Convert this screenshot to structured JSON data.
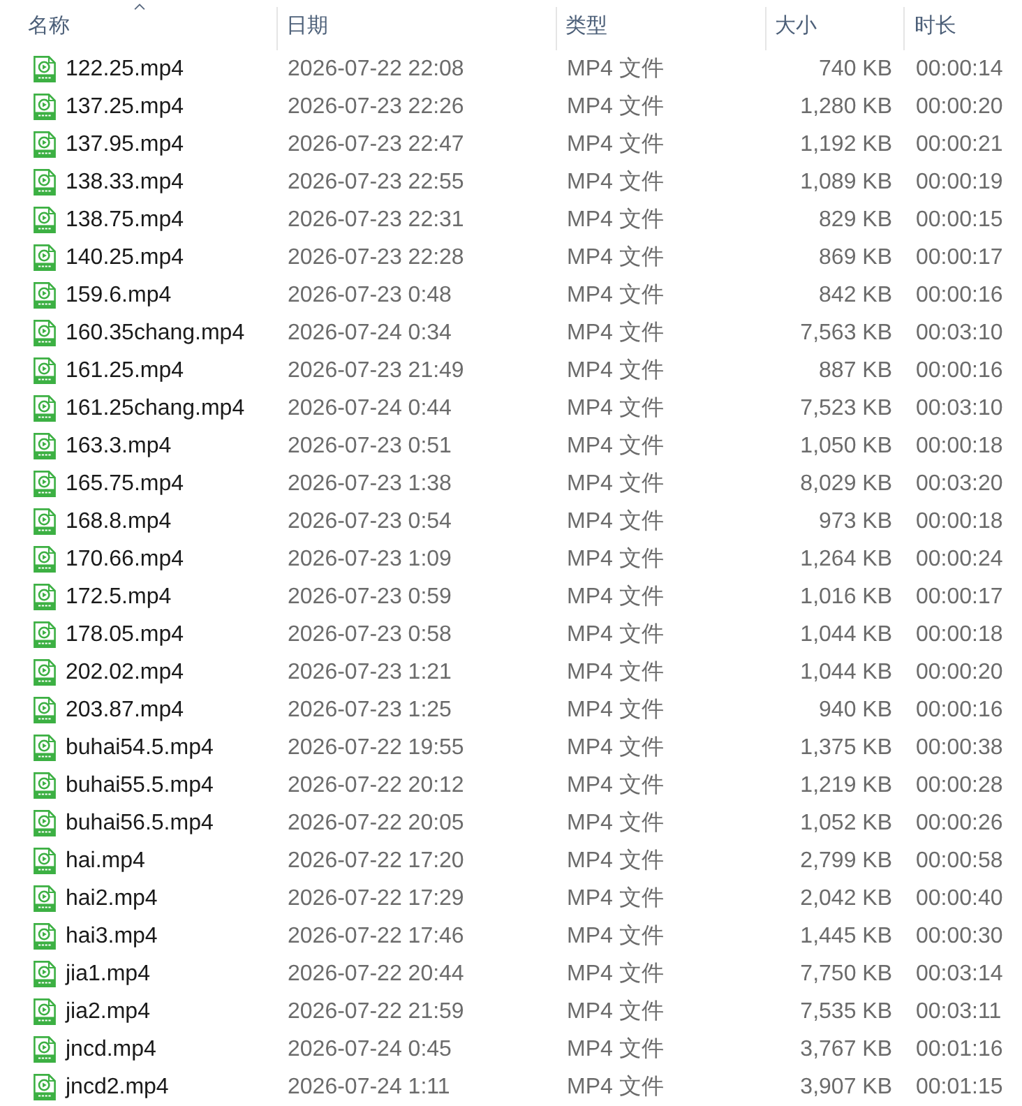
{
  "table": {
    "columns": [
      {
        "label": "名称",
        "sorted": true
      },
      {
        "label": "日期",
        "sorted": false
      },
      {
        "label": "类型",
        "sorted": false
      },
      {
        "label": "大小",
        "sorted": false
      },
      {
        "label": "时长",
        "sorted": false
      }
    ],
    "rows": [
      {
        "name": "122.25.mp4",
        "date": "2026-07-22 22:08",
        "type": "MP4 文件",
        "size": "740 KB",
        "duration": "00:00:14"
      },
      {
        "name": "137.25.mp4",
        "date": "2026-07-23 22:26",
        "type": "MP4 文件",
        "size": "1,280 KB",
        "duration": "00:00:20"
      },
      {
        "name": "137.95.mp4",
        "date": "2026-07-23 22:47",
        "type": "MP4 文件",
        "size": "1,192 KB",
        "duration": "00:00:21"
      },
      {
        "name": "138.33.mp4",
        "date": "2026-07-23 22:55",
        "type": "MP4 文件",
        "size": "1,089 KB",
        "duration": "00:00:19"
      },
      {
        "name": "138.75.mp4",
        "date": "2026-07-23 22:31",
        "type": "MP4 文件",
        "size": "829 KB",
        "duration": "00:00:15"
      },
      {
        "name": "140.25.mp4",
        "date": "2026-07-23 22:28",
        "type": "MP4 文件",
        "size": "869 KB",
        "duration": "00:00:17"
      },
      {
        "name": "159.6.mp4",
        "date": "2026-07-23 0:48",
        "type": "MP4 文件",
        "size": "842 KB",
        "duration": "00:00:16"
      },
      {
        "name": "160.35chang.mp4",
        "date": "2026-07-24 0:34",
        "type": "MP4 文件",
        "size": "7,563 KB",
        "duration": "00:03:10"
      },
      {
        "name": "161.25.mp4",
        "date": "2026-07-23 21:49",
        "type": "MP4 文件",
        "size": "887 KB",
        "duration": "00:00:16"
      },
      {
        "name": "161.25chang.mp4",
        "date": "2026-07-24 0:44",
        "type": "MP4 文件",
        "size": "7,523 KB",
        "duration": "00:03:10"
      },
      {
        "name": "163.3.mp4",
        "date": "2026-07-23 0:51",
        "type": "MP4 文件",
        "size": "1,050 KB",
        "duration": "00:00:18"
      },
      {
        "name": "165.75.mp4",
        "date": "2026-07-23 1:38",
        "type": "MP4 文件",
        "size": "8,029 KB",
        "duration": "00:03:20"
      },
      {
        "name": "168.8.mp4",
        "date": "2026-07-23 0:54",
        "type": "MP4 文件",
        "size": "973 KB",
        "duration": "00:00:18"
      },
      {
        "name": "170.66.mp4",
        "date": "2026-07-23 1:09",
        "type": "MP4 文件",
        "size": "1,264 KB",
        "duration": "00:00:24"
      },
      {
        "name": "172.5.mp4",
        "date": "2026-07-23 0:59",
        "type": "MP4 文件",
        "size": "1,016 KB",
        "duration": "00:00:17"
      },
      {
        "name": "178.05.mp4",
        "date": "2026-07-23 0:58",
        "type": "MP4 文件",
        "size": "1,044 KB",
        "duration": "00:00:18"
      },
      {
        "name": "202.02.mp4",
        "date": "2026-07-23 1:21",
        "type": "MP4 文件",
        "size": "1,044 KB",
        "duration": "00:00:20"
      },
      {
        "name": "203.87.mp4",
        "date": "2026-07-23 1:25",
        "type": "MP4 文件",
        "size": "940 KB",
        "duration": "00:00:16"
      },
      {
        "name": "buhai54.5.mp4",
        "date": "2026-07-22 19:55",
        "type": "MP4 文件",
        "size": "1,375 KB",
        "duration": "00:00:38"
      },
      {
        "name": "buhai55.5.mp4",
        "date": "2026-07-22 20:12",
        "type": "MP4 文件",
        "size": "1,219 KB",
        "duration": "00:00:28"
      },
      {
        "name": "buhai56.5.mp4",
        "date": "2026-07-22 20:05",
        "type": "MP4 文件",
        "size": "1,052 KB",
        "duration": "00:00:26"
      },
      {
        "name": "hai.mp4",
        "date": "2026-07-22 17:20",
        "type": "MP4 文件",
        "size": "2,799 KB",
        "duration": "00:00:58"
      },
      {
        "name": "hai2.mp4",
        "date": "2026-07-22 17:29",
        "type": "MP4 文件",
        "size": "2,042 KB",
        "duration": "00:00:40"
      },
      {
        "name": "hai3.mp4",
        "date": "2026-07-22 17:46",
        "type": "MP4 文件",
        "size": "1,445 KB",
        "duration": "00:00:30"
      },
      {
        "name": "jia1.mp4",
        "date": "2026-07-22 20:44",
        "type": "MP4 文件",
        "size": "7,750 KB",
        "duration": "00:03:14"
      },
      {
        "name": "jia2.mp4",
        "date": "2026-07-22 21:59",
        "type": "MP4 文件",
        "size": "7,535 KB",
        "duration": "00:03:11"
      },
      {
        "name": "jncd.mp4",
        "date": "2026-07-24 0:45",
        "type": "MP4 文件",
        "size": "3,767 KB",
        "duration": "00:01:16"
      },
      {
        "name": "jncd2.mp4",
        "date": "2026-07-24 1:11",
        "type": "MP4 文件",
        "size": "3,907 KB",
        "duration": "00:01:15"
      }
    ]
  }
}
